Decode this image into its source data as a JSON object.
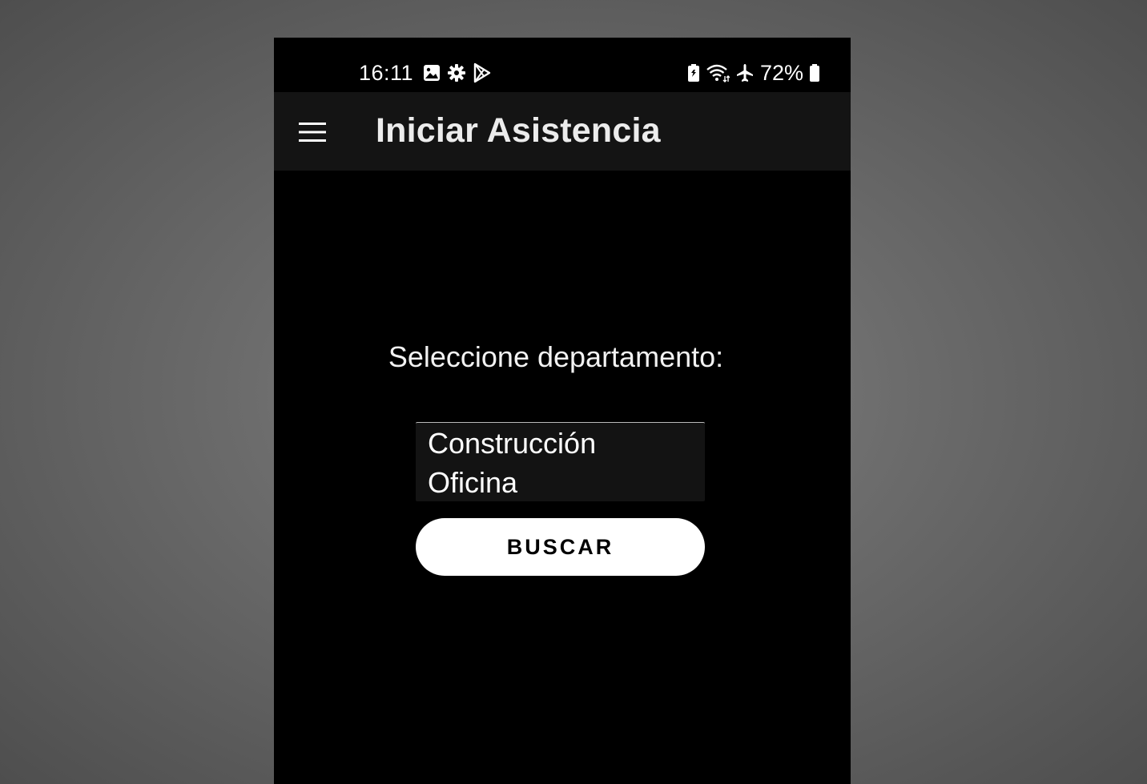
{
  "status_bar": {
    "time": "16:11",
    "left_icons": [
      "image-icon",
      "gear-icon",
      "play-store-icon"
    ],
    "right_icons": [
      "battery-saver-icon",
      "wifi-icon",
      "airplane-icon"
    ],
    "battery_percent": "72%"
  },
  "app_bar": {
    "title": "Iniciar Asistencia",
    "menu_icon": "hamburger-menu-icon"
  },
  "main": {
    "prompt_label": "Seleccione departamento:",
    "departments": [
      "Construcción",
      "Oficina"
    ],
    "search_button_label": "BUSCAR"
  },
  "colors": {
    "background": "#000000",
    "app_bar": "#141414",
    "list_background": "#131313",
    "button_background": "#ffffff",
    "text": "#ffffff"
  }
}
